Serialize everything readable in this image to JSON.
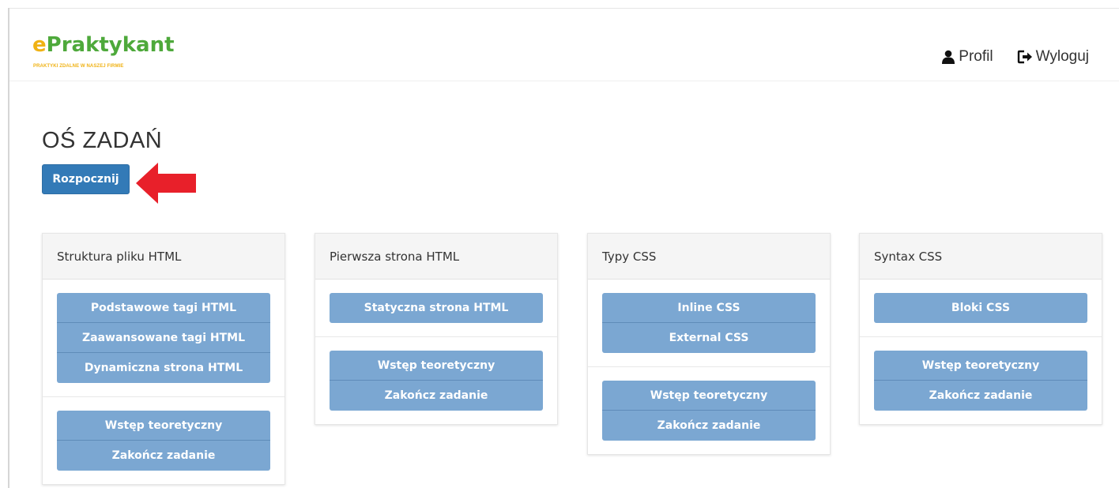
{
  "brand": {
    "name_prefix": "e",
    "name_rest": "Praktykant",
    "tagline": "PRAKTYKI ZDALNE W NASZEJ FIRMIE"
  },
  "nav": {
    "profile_label": "Profil",
    "logout_label": "Wyloguj",
    "profile_icon": "user-icon",
    "logout_icon": "sign-out-icon"
  },
  "page": {
    "title": "OŚ ZADAŃ",
    "start_button": "Rozpocznij",
    "arrow_icon": "red-arrow-left-icon",
    "arrow_color": "#e8202a"
  },
  "colors": {
    "primary": "#337ab7",
    "task_button": "#7ba7d2",
    "brand_green": "#4ea93b",
    "brand_yellow": "#f0b214"
  },
  "panels": [
    {
      "title": "Struktura pliku HTML",
      "tasks": [
        "Podstawowe tagi HTML",
        "Zaawansowane tagi HTML",
        "Dynamiczna strona HTML"
      ],
      "actions": [
        "Wstęp teoretyczny",
        "Zakończ zadanie"
      ]
    },
    {
      "title": "Pierwsza strona HTML",
      "tasks": [
        "Statyczna strona HTML"
      ],
      "actions": [
        "Wstęp teoretyczny",
        "Zakończ zadanie"
      ]
    },
    {
      "title": "Typy CSS",
      "tasks": [
        "Inline CSS",
        "External CSS"
      ],
      "actions": [
        "Wstęp teoretyczny",
        "Zakończ zadanie"
      ]
    },
    {
      "title": "Syntax CSS",
      "tasks": [
        "Bloki CSS"
      ],
      "actions": [
        "Wstęp teoretyczny",
        "Zakończ zadanie"
      ]
    }
  ]
}
